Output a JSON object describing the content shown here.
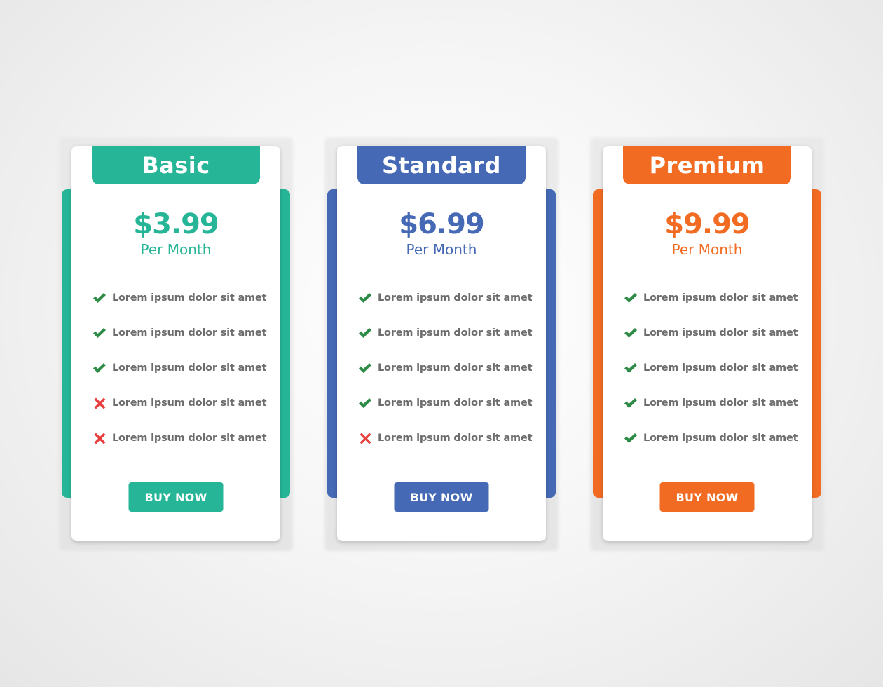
{
  "plans": [
    {
      "name": "Basic",
      "price": "$3.99",
      "period": "Per Month",
      "color": "#26b597",
      "button_label": "BUY NOW",
      "features": [
        {
          "text": "Lorem ipsum dolor sit amet",
          "included": true
        },
        {
          "text": "Lorem ipsum dolor sit amet",
          "included": true
        },
        {
          "text": "Lorem ipsum dolor sit amet",
          "included": true
        },
        {
          "text": "Lorem ipsum dolor sit amet",
          "included": false
        },
        {
          "text": "Lorem ipsum dolor sit amet",
          "included": false
        }
      ]
    },
    {
      "name": "Standard",
      "price": "$6.99",
      "period": "Per Month",
      "color": "#4569b4",
      "button_label": "BUY NOW",
      "features": [
        {
          "text": "Lorem ipsum dolor sit amet",
          "included": true
        },
        {
          "text": "Lorem ipsum dolor sit amet",
          "included": true
        },
        {
          "text": "Lorem ipsum dolor sit amet",
          "included": true
        },
        {
          "text": "Lorem ipsum dolor sit amet",
          "included": true
        },
        {
          "text": "Lorem ipsum dolor sit amet",
          "included": false
        }
      ]
    },
    {
      "name": "Premium",
      "price": "$9.99",
      "period": "Per Month",
      "color": "#f26b22",
      "button_label": "BUY NOW",
      "features": [
        {
          "text": "Lorem ipsum dolor sit amet",
          "included": true
        },
        {
          "text": "Lorem ipsum dolor sit amet",
          "included": true
        },
        {
          "text": "Lorem ipsum dolor sit amet",
          "included": true
        },
        {
          "text": "Lorem ipsum dolor sit amet",
          "included": true
        },
        {
          "text": "Lorem ipsum dolor sit amet",
          "included": true
        }
      ]
    }
  ],
  "icons": {
    "included": "check-icon",
    "excluded": "cross-icon"
  },
  "colors": {
    "check": "#2e8b47",
    "cross": "#e8403f",
    "feature_text": "#6d6d6d"
  }
}
